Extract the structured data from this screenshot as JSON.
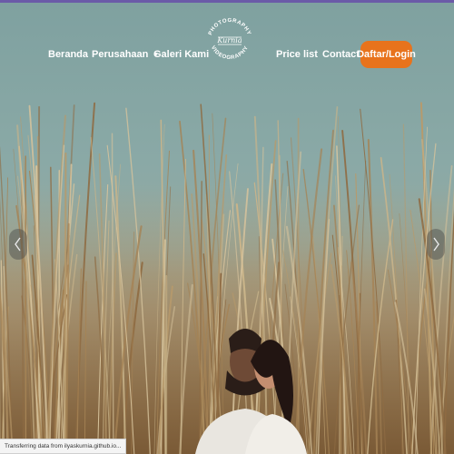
{
  "nav": {
    "items": [
      {
        "label": "Beranda"
      },
      {
        "label": "Perusahaan",
        "caret": "▼"
      },
      {
        "label": "Galeri Kami"
      },
      {
        "label": "Price list"
      },
      {
        "label": "Contact"
      }
    ],
    "login_label": "Daftar/Login",
    "login_color": "#e8731c"
  },
  "logo": {
    "top_text": "PHOTOGRAPHY",
    "bottom_text": "VIDEOGRAPHY",
    "script_text": "Kurnia"
  },
  "hero": {
    "prev_icon": "chevron-left-icon",
    "next_icon": "chevron-right-icon"
  },
  "status": {
    "text": "Transferring data from ilyaskurnia.github.io..."
  },
  "colors": {
    "accent_line": "#6b5aa8"
  }
}
